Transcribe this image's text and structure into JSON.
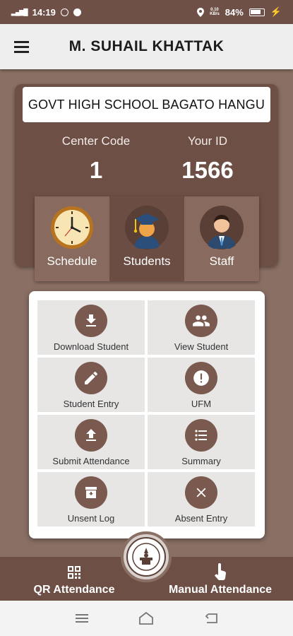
{
  "status_bar": {
    "time": "14:19",
    "net_speed_top": "0.10",
    "net_speed_bottom": "KB/s",
    "battery": "84%"
  },
  "header": {
    "title": "M. SUHAIL KHATTAK"
  },
  "info": {
    "school_name": "GOVT HIGH SCHOOL BAGATO HANGU",
    "center_code_label": "Center Code",
    "center_code_value": "1",
    "your_id_label": "Your ID",
    "your_id_value": "1566"
  },
  "tabs": [
    {
      "label": "Schedule",
      "icon": "clock-icon"
    },
    {
      "label": "Students",
      "icon": "graduate-icon",
      "active": true
    },
    {
      "label": "Staff",
      "icon": "staff-icon"
    }
  ],
  "actions": [
    {
      "label": "Download Student",
      "icon": "download-icon"
    },
    {
      "label": "View Student",
      "icon": "people-icon"
    },
    {
      "label": "Student Entry",
      "icon": "pencil-icon"
    },
    {
      "label": "UFM",
      "icon": "alert-icon"
    },
    {
      "label": "Submit Attendance",
      "icon": "upload-icon"
    },
    {
      "label": "Summary",
      "icon": "list-icon"
    },
    {
      "label": "Unsent Log",
      "icon": "archive-icon"
    },
    {
      "label": "Absent Entry",
      "icon": "close-icon"
    }
  ],
  "bottom_bar": {
    "qr_label": "QR Attendance",
    "manual_label": "Manual Attendance"
  },
  "colors": {
    "primary_brown": "#6d4f45",
    "background": "#8a7064",
    "icon_circle": "#7a5a4f"
  }
}
